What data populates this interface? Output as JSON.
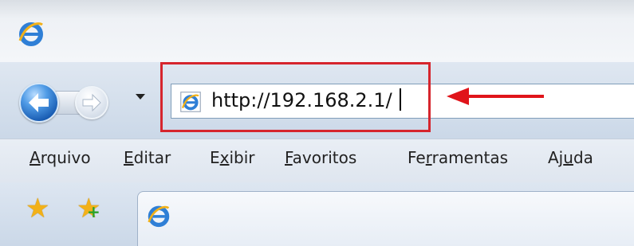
{
  "browser": {
    "address_bar": {
      "url": "http://192.168.2.1/"
    },
    "menu": {
      "items": [
        {
          "pre": "",
          "ul": "A",
          "post": "rquivo"
        },
        {
          "pre": "",
          "ul": "E",
          "post": "ditar"
        },
        {
          "pre": "E",
          "ul": "x",
          "post": "ibir"
        },
        {
          "pre": "",
          "ul": "F",
          "post": "avoritos"
        },
        {
          "pre": "Fe",
          "ul": "r",
          "post": "ramentas"
        },
        {
          "pre": "Aj",
          "ul": "u",
          "post": "da"
        }
      ]
    },
    "icons": {
      "app": "internet-explorer-icon",
      "back": "back-arrow-icon",
      "forward": "forward-arrow-icon",
      "recent_pages": "chevron-down-icon",
      "favorites": "star-icon",
      "add_favorite": "add-favorite-icon"
    }
  },
  "annotation": {
    "color": "#e0141a",
    "highlight": "address-bar-url",
    "arrow_direction": "left"
  }
}
